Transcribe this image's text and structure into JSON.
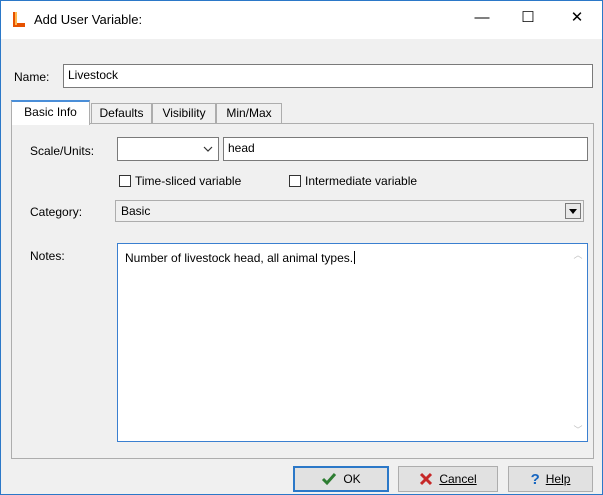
{
  "window": {
    "title": "Add User Variable:"
  },
  "window_controls": {
    "minimize": "—",
    "maximize": "☐",
    "close": "✕"
  },
  "name": {
    "label": "Name:",
    "value": "Livestock"
  },
  "tabs": [
    {
      "label": "Basic Info",
      "active": true
    },
    {
      "label": "Defaults"
    },
    {
      "label": "Visibility"
    },
    {
      "label": "Min/Max"
    }
  ],
  "basic_info": {
    "scale_units_label": "Scale/Units:",
    "scale_value": "",
    "units_value": "head",
    "time_sliced_label": "Time-sliced variable",
    "time_sliced_checked": false,
    "intermediate_label": "Intermediate variable",
    "intermediate_checked": false,
    "category_label": "Category:",
    "category_value": "Basic",
    "notes_label": "Notes:",
    "notes_value": "Number of livestock head, all animal types."
  },
  "buttons": {
    "ok": "OK",
    "cancel": "Cancel",
    "help": "Help"
  },
  "icons": {
    "ok_icon_color": "#2e7d32",
    "cancel_icon_color": "#c62828",
    "help_icon_color": "#1565c0",
    "app_icon_color": "#e65100"
  }
}
